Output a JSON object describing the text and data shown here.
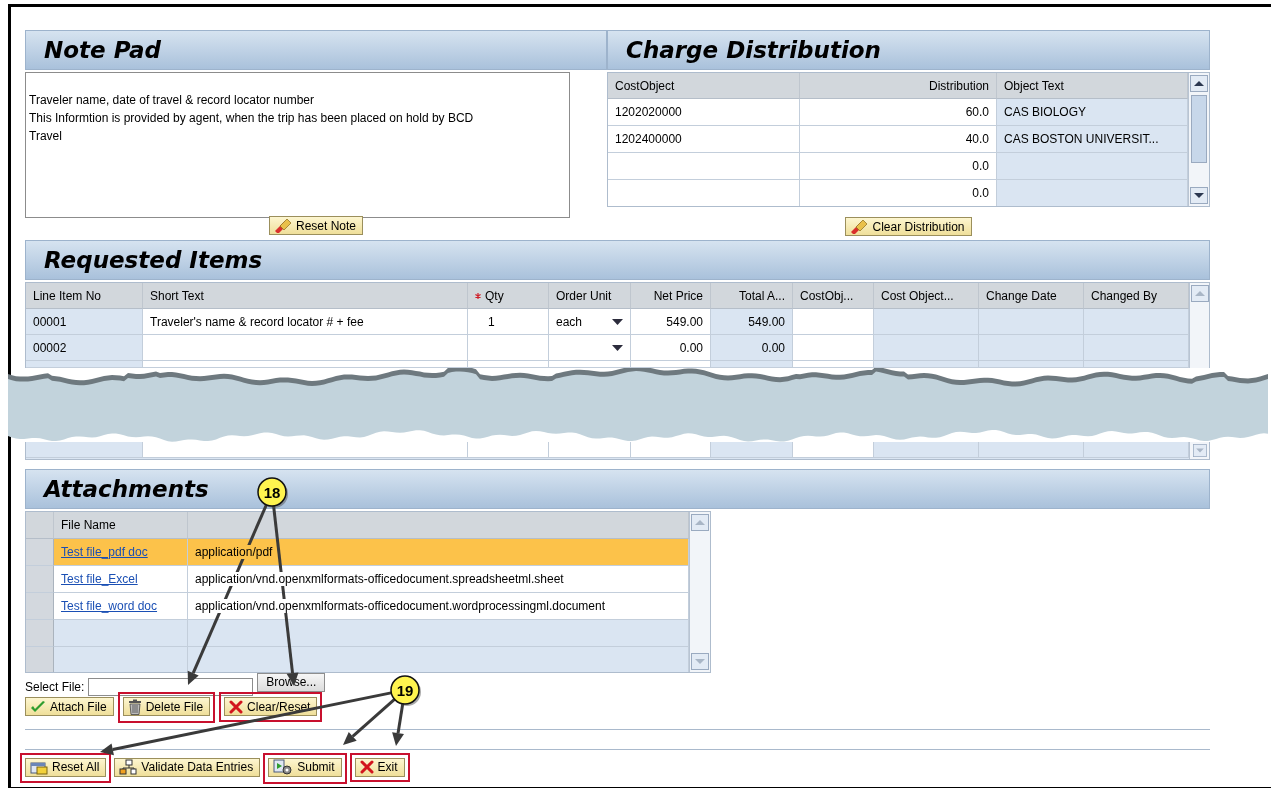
{
  "note_pad": {
    "title": "Note Pad",
    "text": "Traveler name, date of travel & record locator number\nThis Informtion is provided by agent, when the trip has been placed on hold by BCD Travel",
    "button": {
      "label": "Reset Note",
      "highlighted": false
    }
  },
  "charge_distribution": {
    "title": "Charge Distribution",
    "columns": [
      {
        "label": "CostObject",
        "editable": true
      },
      {
        "label": "Distribution",
        "editable": true
      },
      {
        "label": "Object Text",
        "editable": false
      }
    ],
    "rows": [
      {
        "cost_object": "1202020000",
        "distribution": "60.0",
        "object_text": "CAS BIOLOGY"
      },
      {
        "cost_object": "1202400000",
        "distribution": "40.0",
        "object_text": "CAS BOSTON UNIVERSIT..."
      },
      {
        "distribution": "0.0"
      },
      {
        "distribution": "0.0"
      }
    ],
    "button": {
      "label": "Clear Distribution",
      "highlighted": false
    }
  },
  "requested_items": {
    "title": "Requested Items",
    "columns": [
      {
        "label": "Line Item No",
        "editable": false,
        "required": false
      },
      {
        "label": "Short Text",
        "editable": true,
        "required": false
      },
      {
        "label": "Qty",
        "editable": true,
        "required": true
      },
      {
        "label": "Order Unit",
        "editable": true,
        "required": false
      },
      {
        "label": "Net Price",
        "editable": true,
        "required": false
      },
      {
        "label": "Total A...",
        "editable": false,
        "required": false
      },
      {
        "label": "CostObj...",
        "editable": true,
        "required": false
      },
      {
        "label": "Cost Object...",
        "editable": false,
        "required": false
      },
      {
        "label": "Change Date",
        "editable": false,
        "required": false
      },
      {
        "label": "Changed By",
        "editable": false,
        "required": false
      }
    ],
    "rows": [
      {
        "line_item_no": "00001",
        "short_text": "Traveler's name & record locator # + fee",
        "qty": "1",
        "order_unit": "each",
        "net_price": "549.00",
        "total_amount": "549.00"
      },
      {
        "line_item_no": "00002",
        "net_price": "0.00",
        "total_amount": "0.00"
      }
    ]
  },
  "attachments": {
    "title": "Attachments",
    "columns": [
      "File Name"
    ],
    "files": [
      {
        "name": "Test file_pdf doc",
        "type": "application/pdf",
        "selected": true
      },
      {
        "name": "Test file_Excel",
        "type": "application/vnd.openxmlformats-officedocument.spreadsheetml.sheet",
        "selected": false
      },
      {
        "name": "Test file_word doc",
        "type": "application/vnd.openxmlformats-officedocument.wordprocessingml.document",
        "selected": false
      }
    ],
    "select_file_label": "Select File:",
    "browse_button": "Browse...",
    "buttons": [
      {
        "label": "Attach File",
        "highlighted": false
      },
      {
        "label": "Delete File",
        "highlighted": true
      },
      {
        "label": "Clear/Reset",
        "highlighted": true
      }
    ]
  },
  "actions": [
    {
      "label": "Reset All",
      "highlighted": true
    },
    {
      "label": "Validate Data Entries",
      "highlighted": false
    },
    {
      "label": "Submit",
      "highlighted": true
    },
    {
      "label": "Exit",
      "highlighted": true
    }
  ],
  "callouts": [
    {
      "number": "18"
    },
    {
      "number": "19"
    }
  ]
}
